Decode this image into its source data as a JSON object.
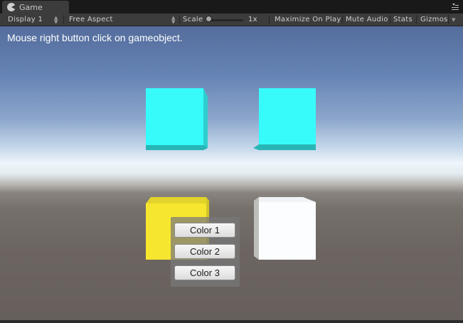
{
  "tab": {
    "label": "Game",
    "icon": "pacman-icon"
  },
  "toolbar": {
    "display": "Display 1",
    "aspect": "Free Aspect",
    "scale_label": "Scale",
    "scale_value": "1x",
    "maximize": "Maximize On Play",
    "mute": "Mute Audio",
    "stats": "Stats",
    "gizmos": "Gizmos"
  },
  "game": {
    "hint": "Mouse right button click on gameobject.",
    "cube_colors": {
      "top_left": "#37fbfb",
      "top_right": "#37fbfb",
      "bottom_left": "#f7e62f",
      "bottom_right": "#fbfdff"
    },
    "menu": {
      "buttons": [
        "Color 1",
        "Color 2",
        "Color 3"
      ]
    }
  }
}
